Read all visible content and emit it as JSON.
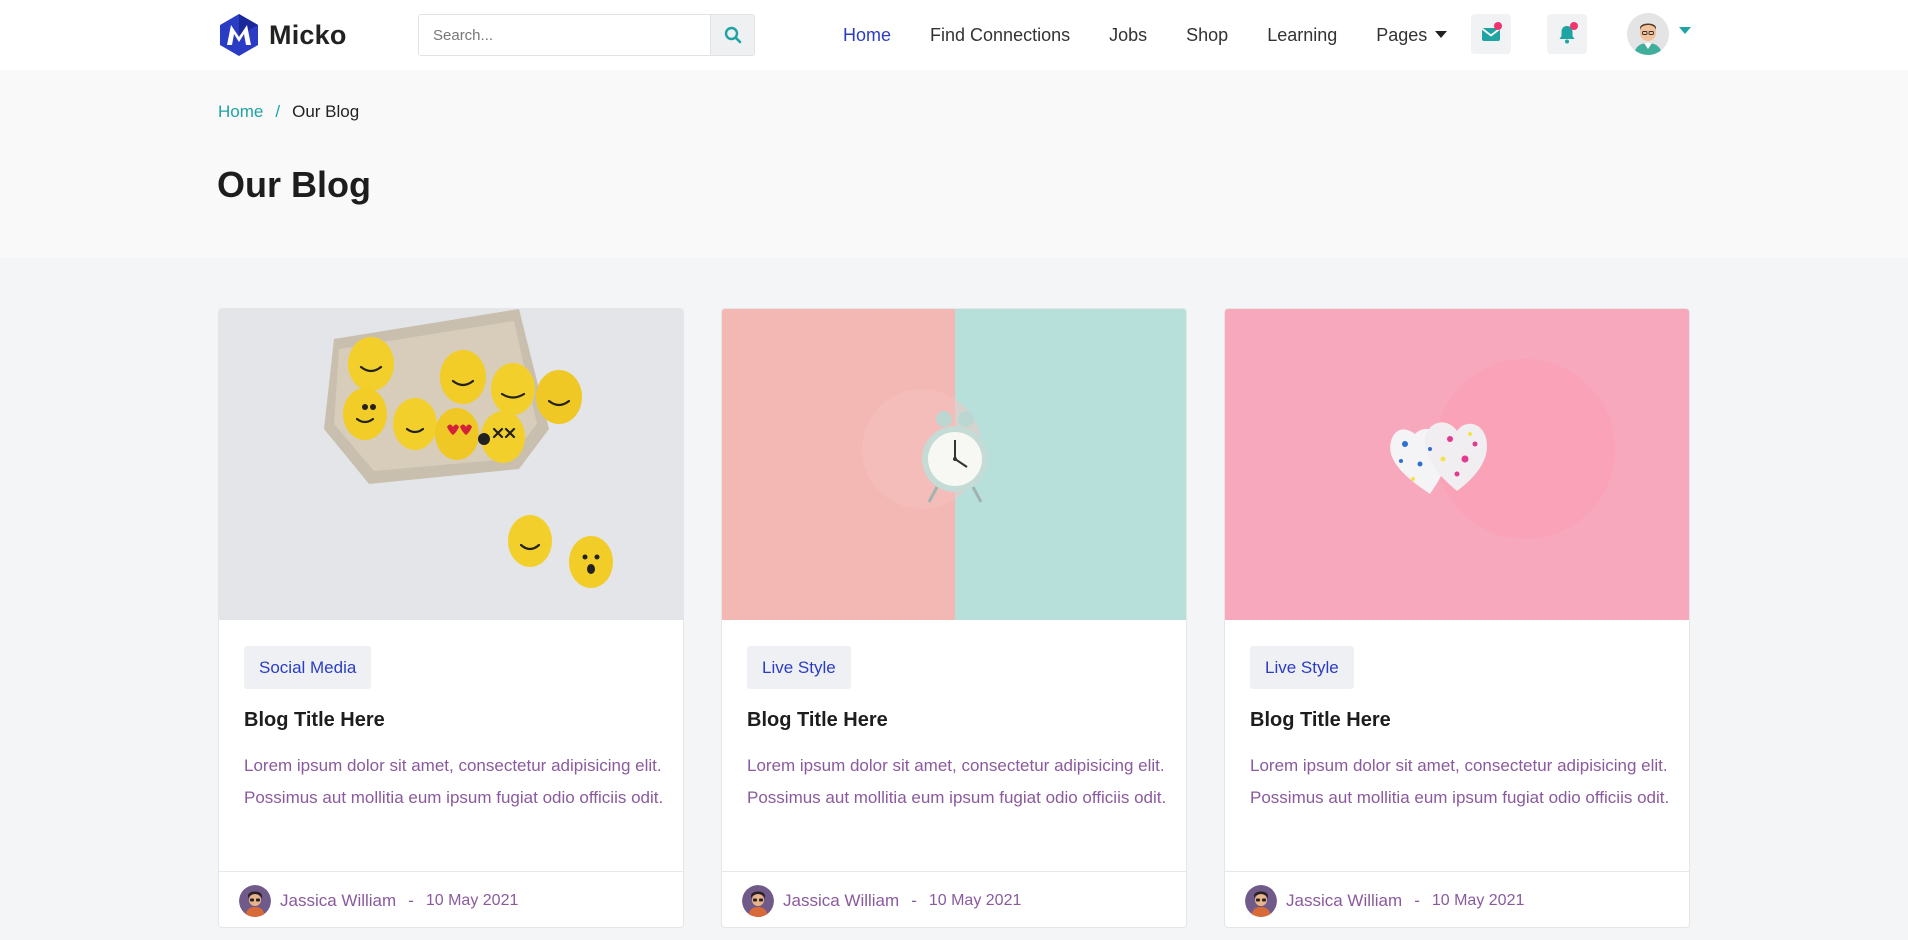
{
  "brand": {
    "name": "Micko"
  },
  "search": {
    "placeholder": "Search..."
  },
  "nav": {
    "items": [
      {
        "label": "Home"
      },
      {
        "label": "Find Connections"
      },
      {
        "label": "Jobs"
      },
      {
        "label": "Shop"
      },
      {
        "label": "Learning"
      },
      {
        "label": "Pages"
      }
    ]
  },
  "breadcrumb": {
    "home": "Home",
    "separator": "/",
    "current": "Our Blog"
  },
  "page": {
    "title": "Our Blog"
  },
  "posts": [
    {
      "category": "Social Media",
      "title": "Blog Title Here",
      "excerpt": "Lorem ipsum dolor sit amet, consectetur adipisicing elit. Possimus aut mollitia eum ipsum fugiat odio officiis odit.",
      "author": "Jassica William",
      "separator": "-",
      "date": "10 May 2021",
      "image_icon": "emoji-eggs-image"
    },
    {
      "category": "Live Style",
      "title": "Blog Title Here",
      "excerpt": "Lorem ipsum dolor sit amet, consectetur adipisicing elit. Possimus aut mollitia eum ipsum fugiat odio officiis odit.",
      "author": "Jassica William",
      "separator": "-",
      "date": "10 May 2021",
      "image_icon": "alarm-clock-image"
    },
    {
      "category": "Live Style",
      "title": "Blog Title Here",
      "excerpt": "Lorem ipsum dolor sit amet, consectetur adipisicing elit. Possimus aut mollitia eum ipsum fugiat odio officiis odit.",
      "author": "Jassica William",
      "separator": "-",
      "date": "10 May 2021",
      "image_icon": "hearts-image"
    }
  ],
  "colors": {
    "accent": "#2b3cc4",
    "teal": "#1fa3a3",
    "notification_dot": "#f2346e",
    "excerpt_text": "#8a5a9e"
  }
}
